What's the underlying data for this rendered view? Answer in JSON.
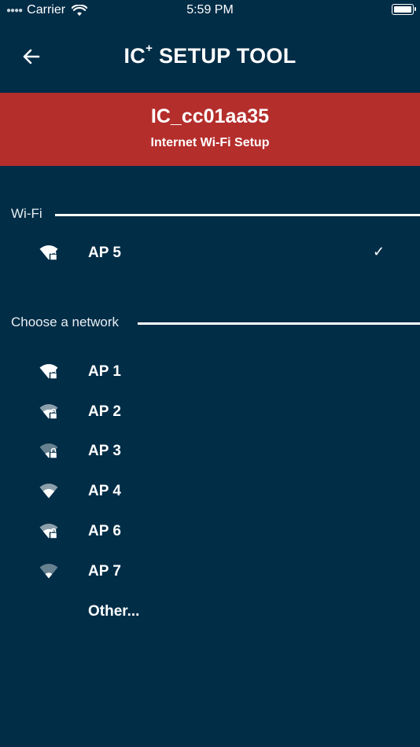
{
  "status_bar": {
    "signal_icon": "cellular-signal-dots",
    "carrier": "Carrier",
    "wifi_icon": "wifi-icon",
    "time": "5:59 PM",
    "battery_icon": "battery-full-icon"
  },
  "header": {
    "back_icon": "arrow-left-icon",
    "title_main": "IC",
    "title_sup": "+",
    "title_rest": " SETUP TOOL"
  },
  "banner": {
    "background_color": "#b42e2c",
    "device_name": "IC_cc01aa35",
    "subtitle": "Internet Wi-Fi Setup"
  },
  "wifi_section": {
    "label": "Wi-Fi",
    "connected": {
      "name": "AP 5",
      "icon": "wifi-lock-icon",
      "selected": true
    }
  },
  "networks_section": {
    "label": "Choose a network",
    "networks": [
      {
        "name": "AP 1",
        "icon": "wifi-lock-icon",
        "locked": true
      },
      {
        "name": "AP 2",
        "icon": "wifi-lock-icon",
        "locked": true
      },
      {
        "name": "AP 3",
        "icon": "wifi-lock-icon",
        "locked": true
      },
      {
        "name": "AP 4",
        "icon": "wifi-icon",
        "locked": false
      },
      {
        "name": "AP 6",
        "icon": "wifi-lock-icon",
        "locked": true
      },
      {
        "name": "AP 7",
        "icon": "wifi-icon",
        "locked": false
      }
    ],
    "other_label": "Other..."
  },
  "colors": {
    "background": "#022d47",
    "text": "#ffffff"
  }
}
